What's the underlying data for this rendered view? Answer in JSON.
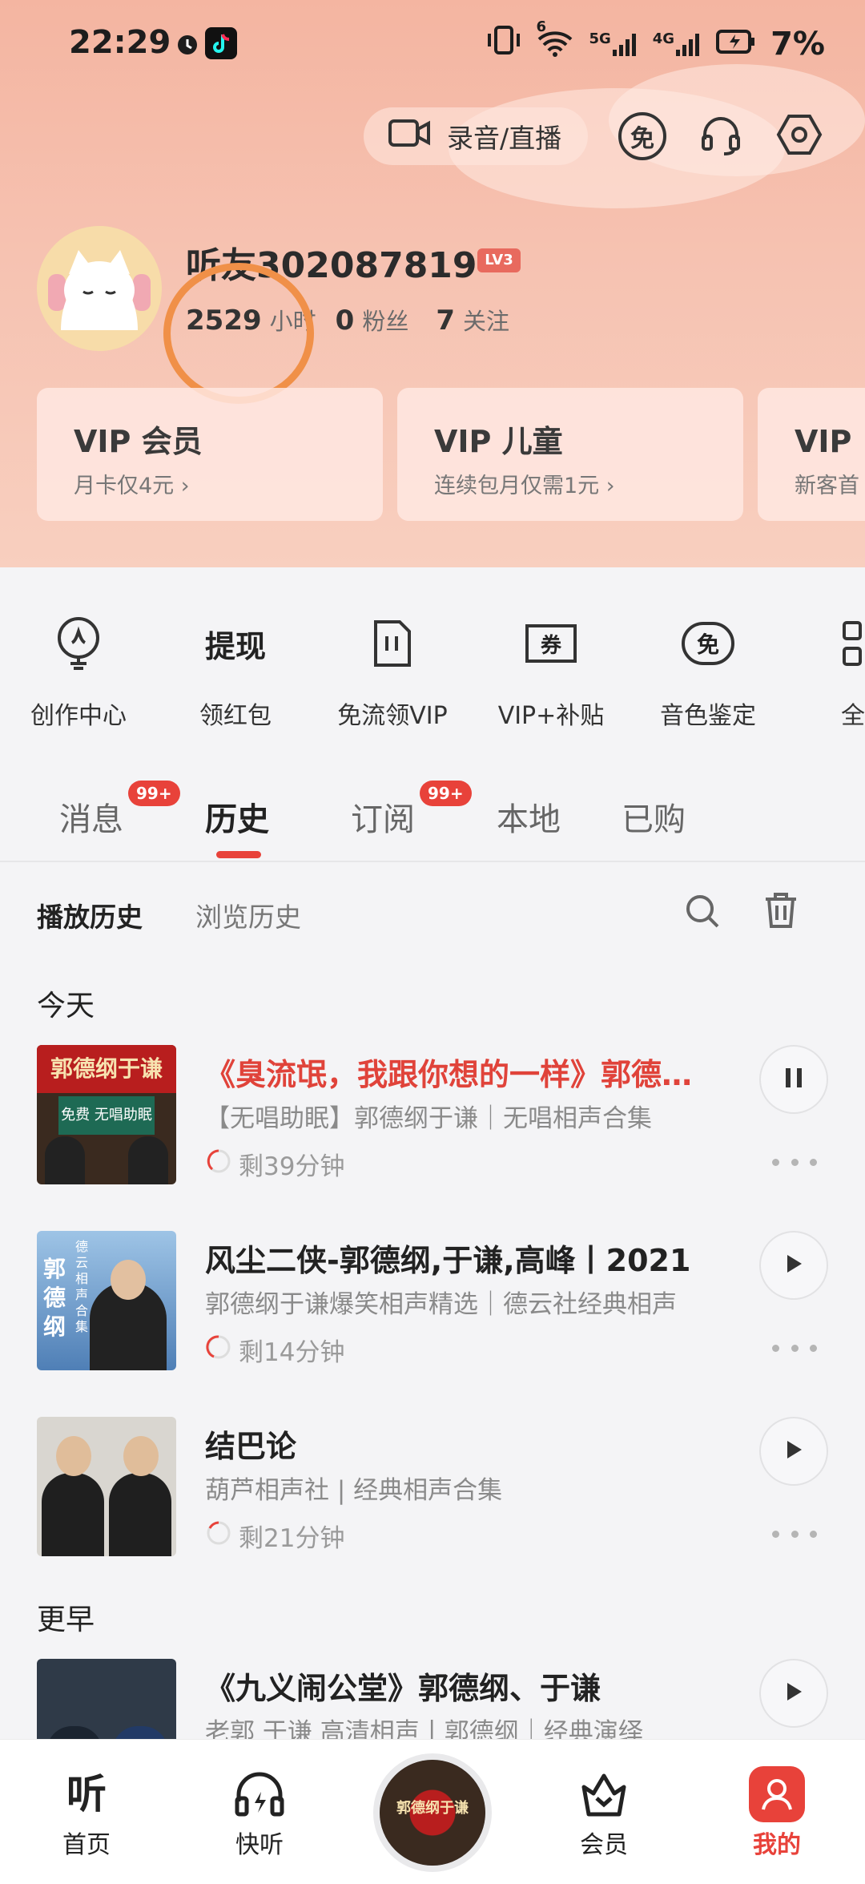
{
  "status_bar": {
    "time": "22:29",
    "network_6": "6",
    "network_5g": "5G",
    "network_4g": "4G",
    "battery": "7%"
  },
  "topbar": {
    "record_label": "录音/直播",
    "free_badge": "免"
  },
  "profile": {
    "username": "听友302087819",
    "level": "LV3",
    "hours_value": "2529",
    "hours_label": "小时",
    "fans_value": "0",
    "fans_label": "粉丝",
    "follow_value": "7",
    "follow_label": "关注"
  },
  "vip_cards": [
    {
      "title": "VIP 会员",
      "subtitle": "月卡仅4元 ›"
    },
    {
      "title": "VIP 儿童",
      "subtitle": "连续包月仅需1元 ›"
    },
    {
      "title": "VIP 白",
      "subtitle": "新客首"
    }
  ],
  "quick_actions": [
    {
      "label": "创作中心",
      "icon": "bulb-icon"
    },
    {
      "label": "领红包",
      "icon_text": "提现"
    },
    {
      "label": "免流领VIP",
      "icon": "sim-card-icon"
    },
    {
      "label": "VIP+补贴",
      "icon_text": "券"
    },
    {
      "label": "音色鉴定",
      "icon_text": "免"
    },
    {
      "label": "全部",
      "icon": "grid-icon"
    }
  ],
  "tabs": [
    {
      "label": "消息",
      "badge": "99+"
    },
    {
      "label": "历史"
    },
    {
      "label": "订阅",
      "badge": "99+"
    },
    {
      "label": "本地"
    },
    {
      "label": "已购"
    }
  ],
  "subtabs": {
    "play_history": "播放历史",
    "browse_history": "浏览历史"
  },
  "sections": {
    "today": "今天",
    "earlier": "更早"
  },
  "history_items": [
    {
      "title": "《臭流氓，我跟你想的一样》郭德纲于谦",
      "subtitle": "【无唱助眠】郭德纲于谦｜无唱相声合集",
      "remaining": "剩39分钟",
      "cover_text": "郭德纲于谦",
      "cover_sub": "免费 无唱助眠"
    },
    {
      "title": "风尘二侠-郭德纲,于谦,高峰丨2021",
      "subtitle": "郭德纲于谦爆笑相声精选｜德云社经典相声",
      "remaining": "剩14分钟",
      "cover_text": "郭德纲",
      "cover_sub": "德云相声合集"
    },
    {
      "title": "结巴论",
      "subtitle": "葫芦相声社 | 经典相声合集",
      "remaining": "剩21分钟"
    },
    {
      "title": "《九义闹公堂》郭德纲、于谦",
      "subtitle": "老郭 于谦 高清相声丨郭德纲｜经典演绎"
    }
  ],
  "bottom_nav": [
    {
      "label": "首页",
      "icon_text": "听"
    },
    {
      "label": "快听"
    },
    {
      "label": "会员"
    },
    {
      "label": "我的"
    }
  ],
  "colors": {
    "accent": "#e8423a",
    "hero_bg": "#f6c2b1",
    "annotation_ring": "#f09048"
  }
}
